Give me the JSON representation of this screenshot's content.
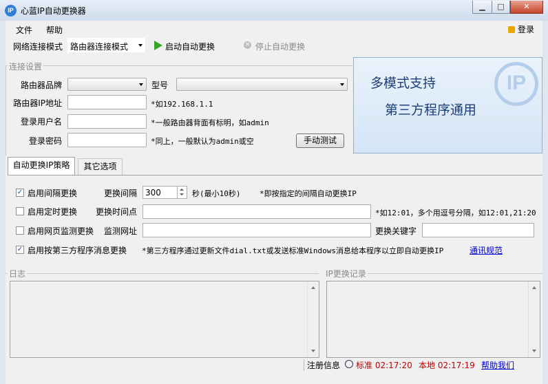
{
  "window": {
    "title": "心蓝IP自动更换器",
    "app_icon": "IP",
    "minimize": "▁",
    "maximize": "□",
    "close": "✕"
  },
  "menu": {
    "file": "文件",
    "help": "帮助",
    "login": "登录"
  },
  "toolbar": {
    "mode_label": "网络连接模式",
    "mode_value": "路由器连接模式",
    "start_label": "启动自动更换",
    "stop_label": "停止自动更换"
  },
  "connection": {
    "group_title": "连接设置",
    "brand_label": "路由器品牌",
    "brand_value": "",
    "model_label": "型号",
    "model_value": "",
    "ip_label": "路由器IP地址",
    "ip_value": "",
    "ip_hint": "*如192.168.1.1",
    "user_label": "登录用户名",
    "user_value": "",
    "user_hint": "*一般路由器背面有标明，如admin",
    "pass_label": "登录密码",
    "pass_value": "",
    "pass_hint": "*同上，一般默认为admin或空",
    "test_button": "手动测试"
  },
  "banner": {
    "line1": "多模式支持",
    "line2": "第三方程序通用",
    "logo_text": "IP"
  },
  "tabs": [
    {
      "label": "自动更换IP策略"
    },
    {
      "label": "其它选项"
    }
  ],
  "strategy": {
    "interval": {
      "checked": true,
      "check_mark": "✓",
      "label": "启用间隔更换",
      "field_label": "更换间隔",
      "value": "300",
      "unit": "秒(最小10秒)",
      "hint": "*即按指定的间隔自动更换IP"
    },
    "timed": {
      "checked": false,
      "label": "启用定时更换",
      "field_label": "更换时间点",
      "value": "",
      "hint": "*如12:01，多个用逗号分隔，如12:01,21:20"
    },
    "webpage": {
      "checked": false,
      "label": "启用网页监测更换",
      "field_label": "监测网址",
      "value": "",
      "keyword_label": "更换关键字",
      "keyword_value": ""
    },
    "thirdparty": {
      "checked": true,
      "check_mark": "✓",
      "label": "启用按第三方程序消息更换",
      "hint": "*第三方程序通过更新文件dial.txt或发送标准Windows消息给本程序以立即自动更换IP",
      "link": "通讯规范"
    }
  },
  "logs": {
    "log_title": "日志",
    "ip_history_title": "IP更换记录"
  },
  "status": {
    "info_label": "注册信息",
    "standard_time": "标准 02:17:20",
    "local_time": "本地 02:17:19",
    "report_link": "帮助我们"
  }
}
